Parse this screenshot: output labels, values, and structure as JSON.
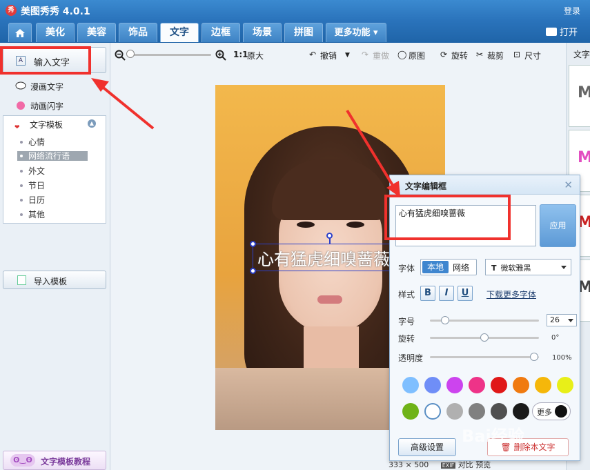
{
  "app": {
    "logo": "秀",
    "title": "美图秀秀 4.0.1",
    "login": "登录",
    "open": "打开"
  },
  "tabs": [
    {
      "label": "美化"
    },
    {
      "label": "美容"
    },
    {
      "label": "饰品"
    },
    {
      "label": "文字"
    },
    {
      "label": "边框"
    },
    {
      "label": "场景"
    },
    {
      "label": "拼图"
    },
    {
      "label": "更多功能 ▾"
    }
  ],
  "left": {
    "input_text": "输入文字",
    "comic_text": "漫画文字",
    "animated_text": "动画闪字",
    "template_title": "文字模板",
    "template_items": [
      "心情",
      "网络流行语",
      "外文",
      "节日",
      "日历",
      "其他"
    ],
    "import": "导入模板",
    "tutorial": "文字模板教程"
  },
  "toolbar": {
    "ratio": "1:1",
    "original_size": "原大",
    "undo": "撤销",
    "redo": "重做",
    "original": "原图",
    "rotate": "旋转",
    "crop": "裁剪",
    "size": "尺寸"
  },
  "canvas": {
    "overlay_text": "心有猛虎细嗅蔷薇",
    "dimensions": "333 × 500",
    "exif": "EXIF",
    "compare": "对比",
    "preview": "预览"
  },
  "right": {
    "title": "文字",
    "thumb_letter": "M"
  },
  "dialog": {
    "title": "文字编辑框",
    "text_value": "心有猛虎细嗅蔷薇",
    "apply": "应用",
    "font_label": "字体",
    "font_local": "本地",
    "font_web": "网络",
    "font_selected": "微软雅黑",
    "style_label": "样式",
    "bold": "B",
    "italic": "I",
    "underline": "U",
    "download_fonts": "下载更多字体",
    "size_label": "字号",
    "size_value": "26",
    "rotate_label": "旋转",
    "rotate_value": "0°",
    "opacity_label": "透明度",
    "opacity_value": "100%",
    "more": "更多",
    "advanced": "高级设置",
    "delete": "删除本文字",
    "swatches": [
      "#7fbfff",
      "#6f8ef7",
      "#cc44ee",
      "#ee3388",
      "#e01818",
      "#f07a10",
      "#f5b70a",
      "#e8ef18",
      "#6fb318",
      "#ffffff",
      "#b0b0b0",
      "#808080",
      "#505050",
      "#1a1a1a"
    ]
  },
  "watermark": "Bai经验"
}
